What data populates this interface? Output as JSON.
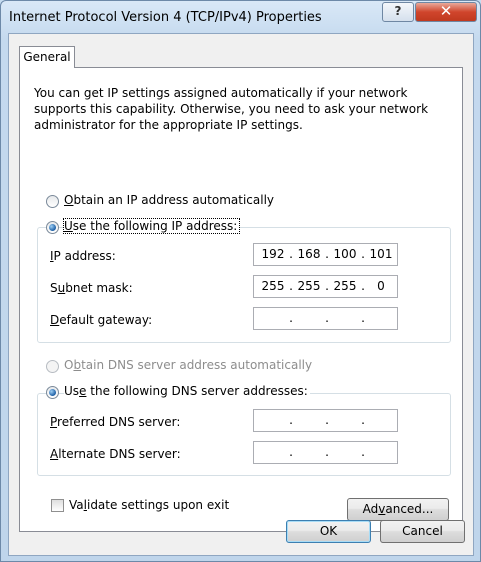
{
  "window": {
    "title": "Internet Protocol Version 4 (TCP/IPv4) Properties",
    "help_label": "?",
    "close_label": "✕"
  },
  "tabs": [
    {
      "label": "General"
    }
  ],
  "intro": "You can get IP settings assigned automatically if your network supports this capability. Otherwise, you need to ask your network administrator for the appropriate IP settings.",
  "ip": {
    "auto_label_mn": "O",
    "auto_label_rest": "btain an IP address automatically",
    "manual_label_mn": "U",
    "manual_label_rest": "se the following IP address:",
    "selected": "manual",
    "fields": [
      {
        "label_mn": "I",
        "label_rest": "P address:",
        "octets": [
          "192",
          "168",
          "100",
          "101"
        ]
      },
      {
        "label_mn": "",
        "label_pre": "S",
        "label_u": "u",
        "label_rest": "bnet mask:",
        "octets": [
          "255",
          "255",
          "255",
          "0"
        ]
      },
      {
        "label_mn": "D",
        "label_rest": "efault gateway:",
        "octets": [
          "",
          "",
          "",
          ""
        ]
      }
    ]
  },
  "dns": {
    "auto_label_pre": "O",
    "auto_label_mn": "b",
    "auto_label_rest": "tain DNS server address automatically",
    "manual_label_pre": "Us",
    "manual_label_mn": "e",
    "manual_label_rest": " the following DNS server addresses:",
    "selected": "manual",
    "fields": [
      {
        "label_mn": "P",
        "label_rest": "referred DNS server:",
        "octets": [
          "",
          "",
          "",
          ""
        ]
      },
      {
        "label_mn": "A",
        "label_rest": "lternate DNS server:",
        "octets": [
          "",
          "",
          "",
          ""
        ]
      }
    ]
  },
  "validate": {
    "pre": "Va",
    "mn": "l",
    "rest": "idate settings upon exit",
    "checked": false
  },
  "buttons": {
    "advanced_pre": "Ad",
    "advanced_mn": "v",
    "advanced_rest": "anced...",
    "ok": "OK",
    "cancel": "Cancel"
  }
}
